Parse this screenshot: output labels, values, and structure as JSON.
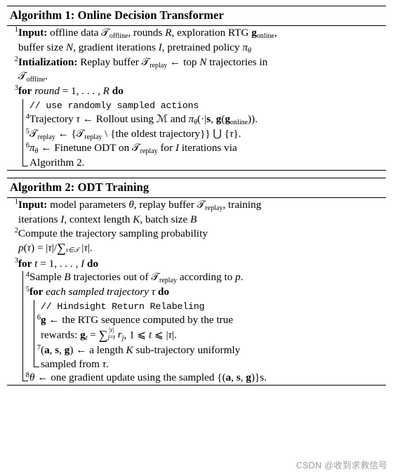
{
  "document": {
    "type": "algorithm-pseudocode",
    "watermark": "CSDN @收到求救信号"
  },
  "algorithm1": {
    "title_prefix": "Algorithm 1:",
    "title": "Online Decision Transformer",
    "lines": [
      {
        "num": "1",
        "indent": 1,
        "keyword": "Input:",
        "text": "offline data 𝒯offline, rounds R, exploration RTG gonline, buffer size N, gradient iterations I, pretrained policy πθ"
      },
      {
        "num": "2",
        "indent": 1,
        "keyword": "Intialization:",
        "text": "Replay buffer 𝒯replay ← top N trajectories in 𝒯offline."
      },
      {
        "num": "3",
        "indent": 1,
        "keyword": "for",
        "text": "round = 1, . . . , R do"
      },
      {
        "num": "",
        "indent": 2,
        "comment": "// use randomly sampled actions"
      },
      {
        "num": "4",
        "indent": 2,
        "text": "Trajectory τ ← Rollout using ℳ and πθ(·|s, g(gonline))."
      },
      {
        "num": "5",
        "indent": 2,
        "text": "𝒯replay ← {𝒯replay \\ {the oldest trajectory}} ⋃ {τ}."
      },
      {
        "num": "6",
        "indent": 2,
        "text": "πθ ← Finetune ODT on 𝒯replay for I iterations via Algorithm 2."
      }
    ]
  },
  "algorithm2": {
    "title_prefix": "Algorithm 2:",
    "title": "ODT Training",
    "lines": [
      {
        "num": "1",
        "indent": 1,
        "keyword": "Input:",
        "text": "model parameters θ, replay buffer 𝒯replay, training iterations I, context length K, batch size B"
      },
      {
        "num": "2",
        "indent": 1,
        "text": "Compute the trajectory sampling probability p(τ) = |τ|/∑τ∈𝒯 |τ|."
      },
      {
        "num": "3",
        "indent": 1,
        "keyword": "for",
        "text": "t = 1, . . . , I do"
      },
      {
        "num": "4",
        "indent": 2,
        "text": "Sample B trajectories out of 𝒯replay according to p."
      },
      {
        "num": "5",
        "indent": 2,
        "keyword": "for",
        "text": "each sampled trajectory τ do"
      },
      {
        "num": "",
        "indent": 3,
        "comment": "// Hindsight Return Relabeling"
      },
      {
        "num": "6",
        "indent": 3,
        "text": "g ← the RTG sequence computed by the true rewards: gt = ∑j=t^|τ| rj, 1 ⩽ t ⩽ |τ|."
      },
      {
        "num": "7",
        "indent": 3,
        "text": "(a, s, g) ← a length K sub-trajectory uniformly sampled from τ."
      },
      {
        "num": "8",
        "indent": 1,
        "text": "θ ← one gradient update using the sampled {(a, s, g)}s."
      }
    ]
  }
}
